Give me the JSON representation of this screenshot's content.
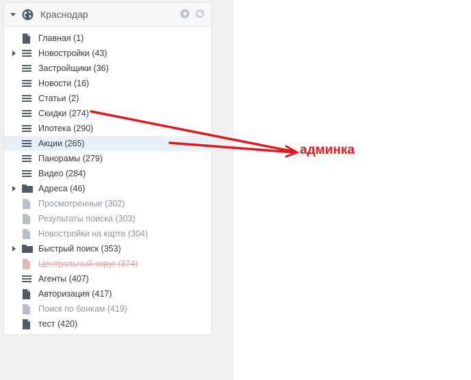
{
  "panel": {
    "title": "Краснодар",
    "header_icons": [
      "globe-icon",
      "add-circle-icon",
      "refresh-icon"
    ]
  },
  "tree": [
    {
      "label": "Главная (1)",
      "icon": "page-icon",
      "expandable": false,
      "state": "normal"
    },
    {
      "label": "Новостройки (43)",
      "icon": "list-icon",
      "expandable": true,
      "state": "normal"
    },
    {
      "label": "Застройщики (36)",
      "icon": "list-icon",
      "expandable": false,
      "state": "normal"
    },
    {
      "label": "Новости (16)",
      "icon": "list-icon",
      "expandable": false,
      "state": "normal"
    },
    {
      "label": "Статьи (2)",
      "icon": "list-icon",
      "expandable": false,
      "state": "normal"
    },
    {
      "label": "Скидки (274)",
      "icon": "list-icon",
      "expandable": false,
      "state": "normal"
    },
    {
      "label": "Ипотека (290)",
      "icon": "list-icon",
      "expandable": false,
      "state": "normal"
    },
    {
      "label": "Акции (265)",
      "icon": "list-icon",
      "expandable": false,
      "state": "selected"
    },
    {
      "label": "Панорамы (279)",
      "icon": "list-icon",
      "expandable": false,
      "state": "normal"
    },
    {
      "label": "Видео (284)",
      "icon": "list-icon",
      "expandable": false,
      "state": "normal"
    },
    {
      "label": "Адреса (46)",
      "icon": "folder-icon",
      "expandable": true,
      "state": "normal"
    },
    {
      "label": "Просмотренные (302)",
      "icon": "page-icon",
      "expandable": false,
      "state": "muted"
    },
    {
      "label": "Результаты поиска (303)",
      "icon": "page-icon",
      "expandable": false,
      "state": "muted"
    },
    {
      "label": "Новостройки на карте (304)",
      "icon": "page-icon",
      "expandable": false,
      "state": "muted"
    },
    {
      "label": "Быстрый поиск (353)",
      "icon": "folder-icon",
      "expandable": true,
      "state": "normal"
    },
    {
      "label": "Центральный округ (374)",
      "icon": "page-icon",
      "expandable": false,
      "state": "deleted"
    },
    {
      "label": "Агенты (407)",
      "icon": "list-icon",
      "expandable": false,
      "state": "normal"
    },
    {
      "label": "Авторизация (417)",
      "icon": "page-icon",
      "expandable": false,
      "state": "normal"
    },
    {
      "label": "Поиск по банкам (419)",
      "icon": "page-icon",
      "expandable": false,
      "state": "muted"
    },
    {
      "label": "тест (420)",
      "icon": "page-icon",
      "expandable": false,
      "state": "normal"
    }
  ],
  "annotation": {
    "text": "админка",
    "color": "#e0191c"
  },
  "colors": {
    "icon_normal": "#4e5a66",
    "icon_muted": "#b4bfcb",
    "icon_deleted": "#e8b4ae",
    "selected_bg": "#e8f1f8"
  }
}
